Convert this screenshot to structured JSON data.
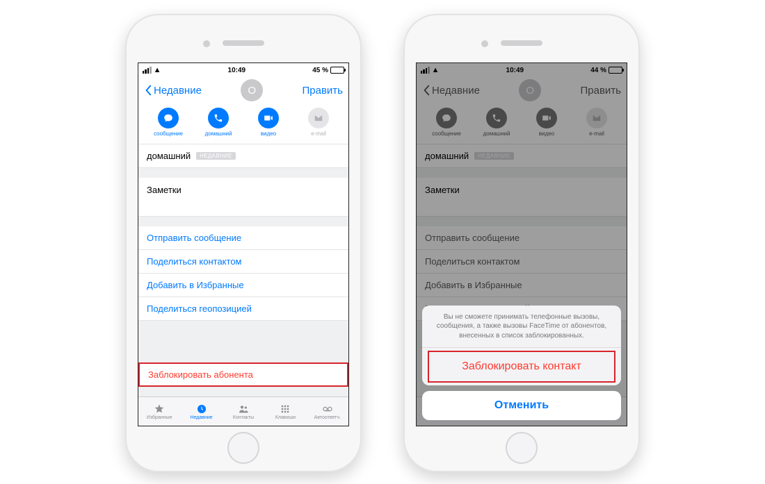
{
  "status": {
    "time": "10:49",
    "battery_left": "45 %",
    "battery_right": "44 %",
    "battery_icon": "■"
  },
  "nav": {
    "back": "Недавние",
    "avatar_initial": "O",
    "edit": "Править"
  },
  "actions": {
    "message": "сообщение",
    "call": "домашний",
    "video": "видео",
    "email": "e-mail"
  },
  "phone_row": {
    "type": "домашний",
    "badge": "НЕДАВНИЕ"
  },
  "notes_label": "Заметки",
  "links": {
    "send_message": "Отправить сообщение",
    "share_contact": "Поделиться контактом",
    "add_favorite": "Добавить в Избранные",
    "share_location": "Поделиться геопозицией",
    "block": "Заблокировать абонента"
  },
  "tabs": {
    "favorites": "Избранные",
    "recents": "Недавние",
    "contacts": "Контакты",
    "keypad": "Клавиши",
    "voicemail": "Автоответч."
  },
  "sheet": {
    "text": "Вы не сможете принимать телефонные вызовы, сообщения, а также вызовы FaceTime от абонентов, внесенных в список заблокированных.",
    "block_contact": "Заблокировать контакт",
    "cancel": "Отменить"
  }
}
